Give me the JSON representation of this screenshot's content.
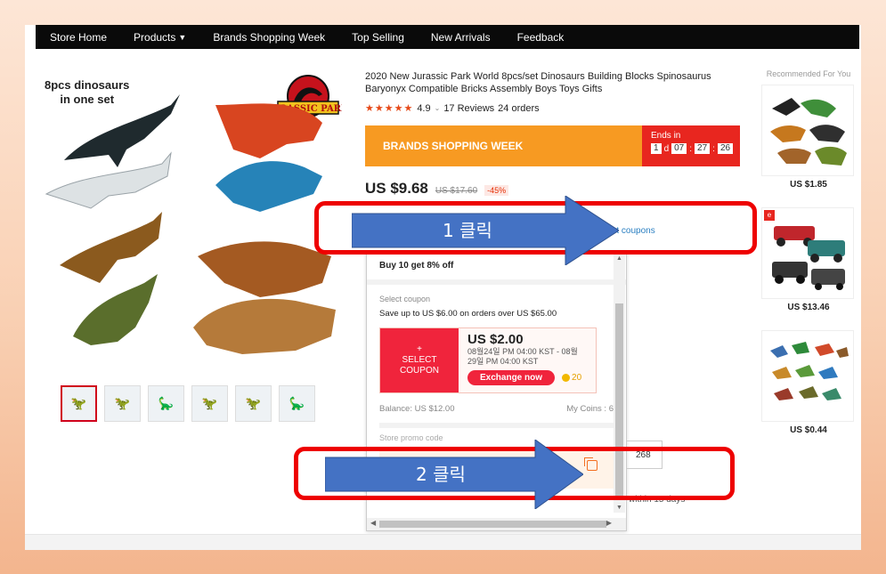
{
  "nav": {
    "items": [
      {
        "label": "Store Home"
      },
      {
        "label": "Products"
      },
      {
        "label": "Brands Shopping Week"
      },
      {
        "label": "Top Selling"
      },
      {
        "label": "New Arrivals"
      },
      {
        "label": "Feedback"
      }
    ]
  },
  "gallery": {
    "caption_line1": "8pcs dinosaurs",
    "caption_line2": "in one set",
    "logo_text": "JURASSIC PARK"
  },
  "product": {
    "title": "2020 New Jurassic Park World 8pcs/set Dinosaurs Building Blocks Spinosaurus Baryonyx Compatible Bricks Assembly Boys Toys Gifts",
    "stars": "★★★★★",
    "rating": "4.9",
    "reviews": "17 Reviews",
    "orders": "24 orders",
    "banner": {
      "label": "BRANDS SHOPPING WEEK",
      "ends_label": "Ends in",
      "days": "1",
      "d": "d",
      "hours": "07",
      "minutes": "27",
      "seconds": "26"
    },
    "price_now": "US $9.68",
    "price_old": "US $17.60",
    "discount": "-45%",
    "get_coupons": "Get coupons",
    "quantity": "268",
    "delivery": "within 15 days"
  },
  "popup": {
    "bulk": "Buy 10 get 8% off",
    "select_coupon_label": "Select coupon",
    "save_text": "Save up to US $6.00 on orders over US $65.00",
    "coupon": {
      "left_plus": "+",
      "left_line1": "SELECT",
      "left_line2": "COUPON",
      "amount": "US $2.00",
      "date_line1": "08월24일 PM 04:00 KST - 08월",
      "date_line2": "29일 PM 04:00 KST",
      "exchange": "Exchange now",
      "coins": "20"
    },
    "balance": "Balance: US $12.00",
    "my_coins": "My Coins : 6",
    "promo_label": "Store promo code"
  },
  "recommended": {
    "title": "Recommended For You",
    "items": [
      {
        "price": "US $1.85"
      },
      {
        "price": "US $13.46"
      },
      {
        "price": "US $0.44"
      }
    ]
  },
  "annotations": {
    "step1": "1 클릭",
    "step2": "2 클릭"
  }
}
